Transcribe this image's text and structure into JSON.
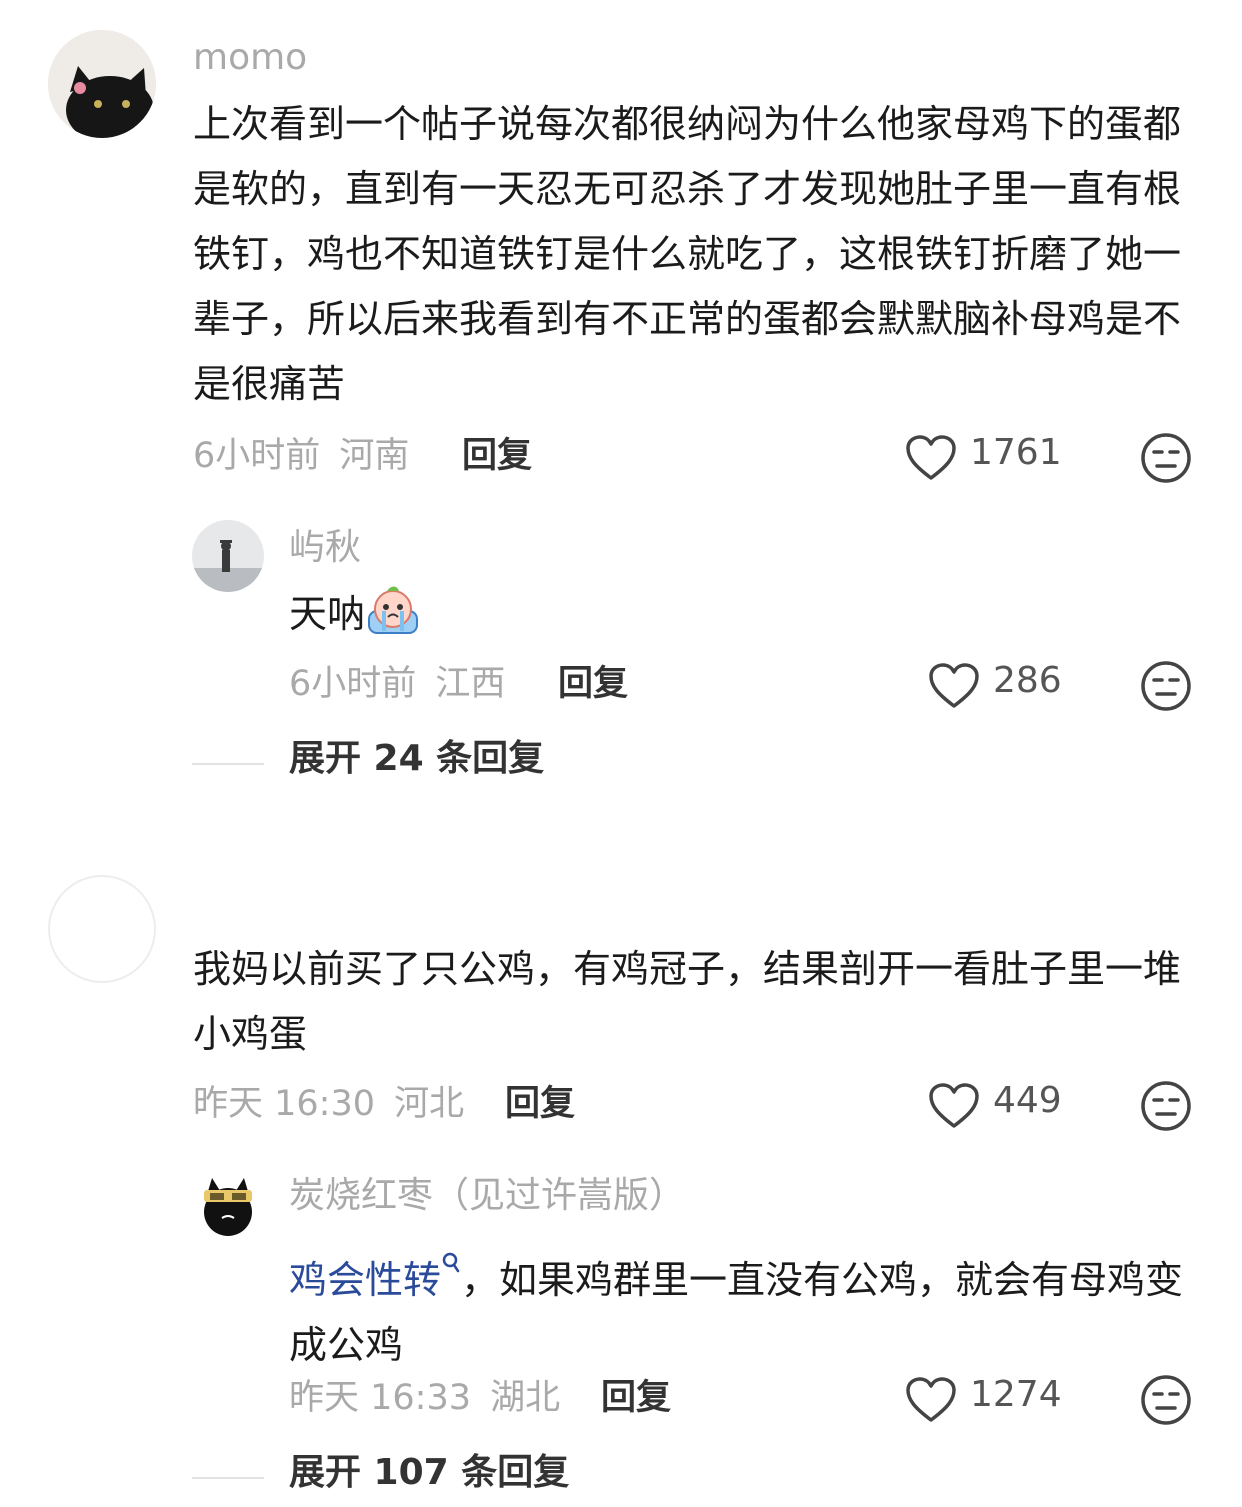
{
  "comments": [
    {
      "author": "momo",
      "text": "上次看到一个帖子说每次都很纳闷为什么他家母鸡下的蛋都是软的，直到有一天忍无可忍杀了才发现她肚子里一直有根铁钉，鸡也不知道铁钉是什么就吃了，这根铁钉折磨了她一辈子，所以后来我看到有不正常的蛋都会默默脑补母鸡是不是很痛苦",
      "time": "6小时前",
      "location": "河南",
      "reply_label": "回复",
      "likes": "1761",
      "replies": [
        {
          "author": "屿秋",
          "text": "天呐",
          "emoji": "crying-emoji",
          "time": "6小时前",
          "location": "江西",
          "reply_label": "回复",
          "likes": "286"
        }
      ],
      "expand_label": "展开 24 条回复"
    },
    {
      "author": "",
      "text": "我妈以前买了只公鸡，有鸡冠子，结果剖开一看肚子里一堆小鸡蛋",
      "time": "昨天 16:30",
      "location": "河北",
      "reply_label": "回复",
      "likes": "449",
      "replies": [
        {
          "author": "炭烧红枣（见过许嵩版）",
          "link_text": "鸡会性转",
          "text": "，如果鸡群里一直没有公鸡，就会有母鸡变成公鸡",
          "time": "昨天 16:33",
          "location": "湖北",
          "reply_label": "回复",
          "likes": "1274"
        }
      ],
      "expand_label": "展开 107 条回复"
    }
  ],
  "icons": {
    "like": "heart-icon",
    "dislike": "meh-face-icon",
    "search_hint": "search-hint-icon"
  },
  "colors": {
    "link": "#2a4a9a",
    "meta": "#a9a9a9"
  }
}
